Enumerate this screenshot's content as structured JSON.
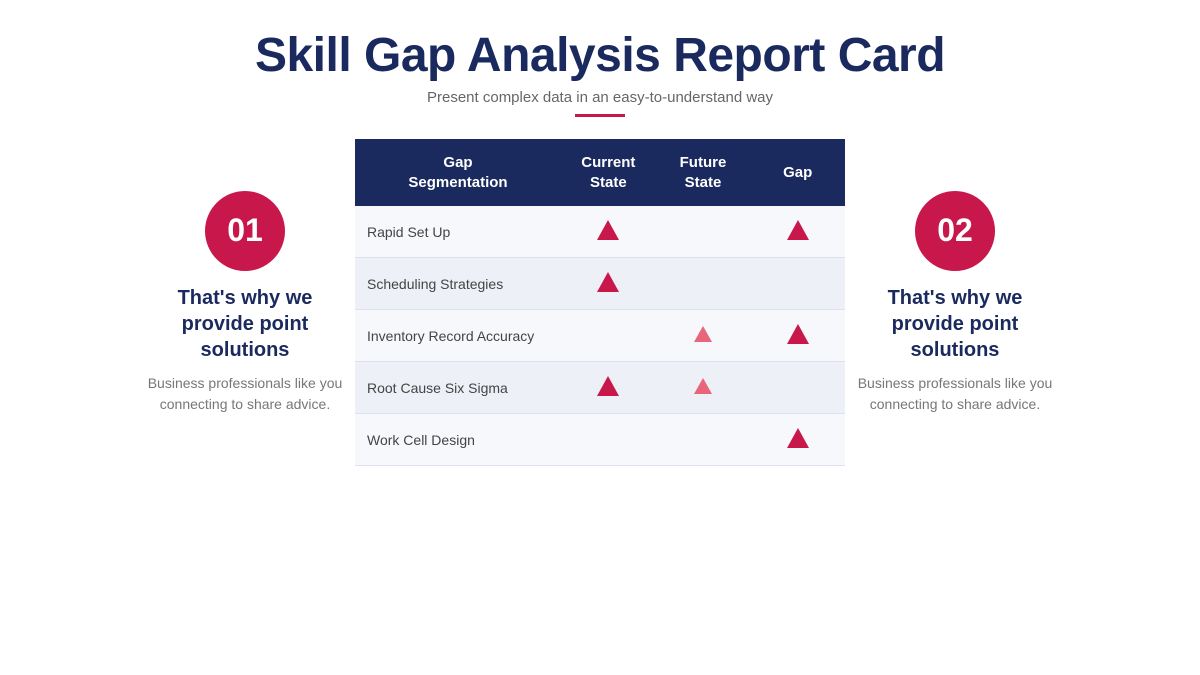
{
  "header": {
    "title": "Skill Gap Analysis Report Card",
    "subtitle": "Present complex data in an easy-to-understand way"
  },
  "left_panel": {
    "badge": "01",
    "heading": "That's why we provide point solutions",
    "text": "Business professionals like you connecting to share advice."
  },
  "right_panel": {
    "badge": "02",
    "heading": "That's why we provide point solutions",
    "text": "Business professionals like you connecting to share advice."
  },
  "table": {
    "headers": [
      "Gap Segmentation",
      "Current State",
      "Future State",
      "Gap"
    ],
    "rows": [
      {
        "label": "Rapid Set Up",
        "current": true,
        "future": false,
        "gap": true
      },
      {
        "label": "Scheduling Strategies",
        "current": true,
        "future": false,
        "gap": false
      },
      {
        "label": "Inventory Record Accuracy",
        "current": false,
        "future": true,
        "gap": true
      },
      {
        "label": "Root Cause Six Sigma",
        "current": true,
        "future": true,
        "gap": false
      },
      {
        "label": "Work Cell Design",
        "current": false,
        "future": false,
        "gap": true
      }
    ]
  }
}
